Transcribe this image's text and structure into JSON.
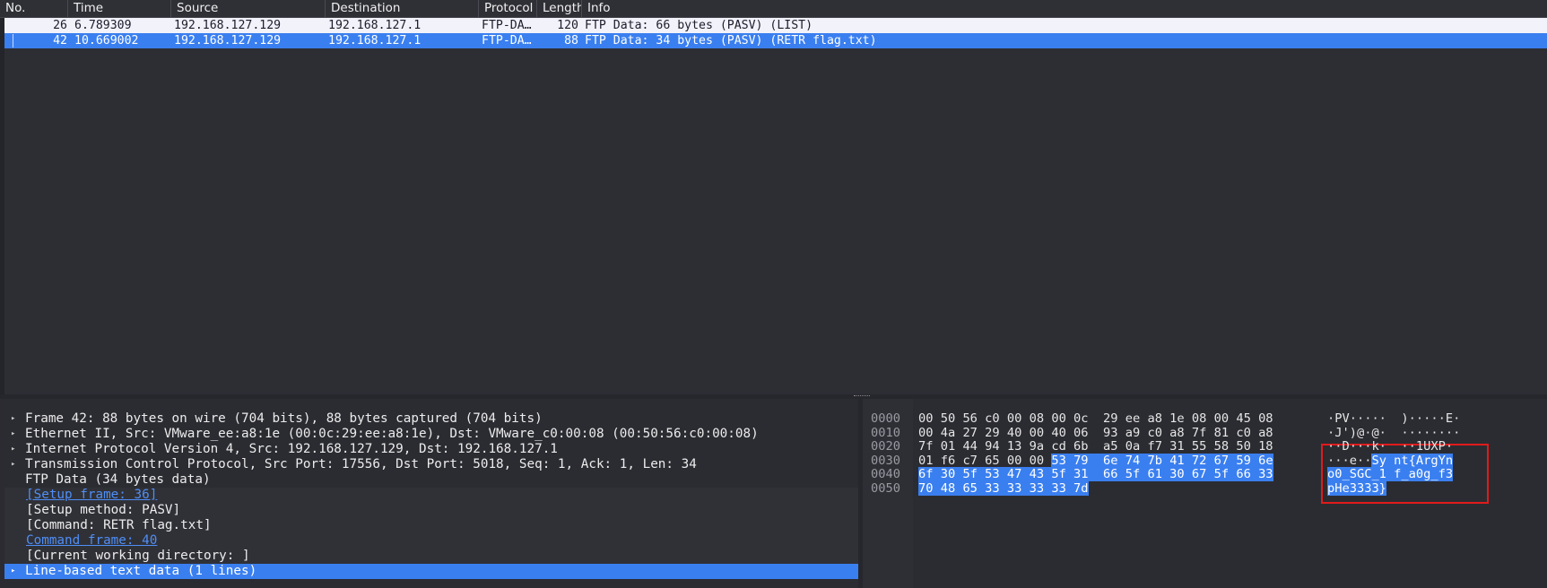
{
  "packet_list": {
    "columns": [
      {
        "label": "No."
      },
      {
        "label": "Time"
      },
      {
        "label": "Source"
      },
      {
        "label": "Destination"
      },
      {
        "label": "Protocol"
      },
      {
        "label": "Length"
      },
      {
        "label": "Info"
      }
    ],
    "rows": [
      {
        "no": "26",
        "time": "6.789309",
        "source": "192.168.127.129",
        "destination": "192.168.127.1",
        "protocol": "FTP-DA…",
        "length": "120",
        "info": "FTP Data: 66 bytes (PASV) (LIST)",
        "selected": false
      },
      {
        "no": "42",
        "time": "10.669002",
        "source": "192.168.127.129",
        "destination": "192.168.127.1",
        "protocol": "FTP-DA…",
        "length": "88",
        "info": "FTP Data: 34 bytes (PASV) (RETR flag.txt)",
        "selected": true
      }
    ]
  },
  "details": {
    "items": [
      {
        "text": "Frame 42: 88 bytes on wire (704 bits), 88 bytes captured (704 bits)",
        "expandable": true
      },
      {
        "text": "Ethernet II, Src: VMware_ee:a8:1e (00:0c:29:ee:a8:1e), Dst: VMware_c0:00:08 (00:50:56:c0:00:08)",
        "expandable": true
      },
      {
        "text": "Internet Protocol Version 4, Src: 192.168.127.129, Dst: 192.168.127.1",
        "expandable": true
      },
      {
        "text": "Transmission Control Protocol, Src Port: 17556, Dst Port: 5018, Seq: 1, Ack: 1, Len: 34",
        "expandable": true
      },
      {
        "text": "FTP Data (34 bytes data)",
        "expandable": false
      },
      {
        "text": "[Setup frame: 36]",
        "link": true,
        "child": true
      },
      {
        "text": "[Setup method: PASV]",
        "child": true
      },
      {
        "text": "[Command: RETR flag.txt]",
        "child": true
      },
      {
        "text": "Command frame: 40",
        "link": true,
        "child": true
      },
      {
        "text": "[Current working directory: ]",
        "child": true
      },
      {
        "text": "Line-based text data (1 lines)",
        "expandable": true,
        "selected": true
      }
    ]
  },
  "hex": {
    "lines": [
      {
        "offset": "0000",
        "hex": "00 50 56 c0 00 08 00 0c  29 ee a8 1e 08 00 45 08",
        "hl_from": -1,
        "ascii": "·PV·····  )·····E·",
        "ascii_hl_from": -1
      },
      {
        "offset": "0010",
        "hex": "00 4a 27 29 40 00 40 06  93 a9 c0 a8 7f 81 c0 a8",
        "hl_from": -1,
        "ascii": "·J')@·@·  ········",
        "ascii_hl_from": -1
      },
      {
        "offset": "0020",
        "hex": "7f 01 44 94 13 9a cd 6b  a5 0a f7 31 55 58 50 18",
        "hl_from": -1,
        "ascii": "··D···k·  ··1UXP·",
        "ascii_hl_from": -1
      },
      {
        "offset": "0030",
        "hex": "01 f6 c7 65 00 00 53 79  6e 74 7b 41 72 67 59 6e",
        "hl_from": 18,
        "ascii": "···e··Sy nt{ArgYn",
        "ascii_hl_from": 6
      },
      {
        "offset": "0040",
        "hex": "6f 30 5f 53 47 43 5f 31  66 5f 61 30 67 5f 66 33",
        "hl_from": 0,
        "ascii": "o0_SGC_1 f_a0g_f3",
        "ascii_hl_from": 0
      },
      {
        "offset": "0050",
        "hex": "70 48 65 33 33 33 33 7d",
        "hl_from": 0,
        "ascii": "pHe3333}",
        "ascii_hl_from": 0
      }
    ]
  },
  "colors": {
    "selection": "#3a7ff0",
    "annotation": "#e01b1b",
    "link": "#4f8ef5",
    "background": "#2b2c32"
  },
  "icons": {
    "expand": "chevron-right-icon"
  }
}
